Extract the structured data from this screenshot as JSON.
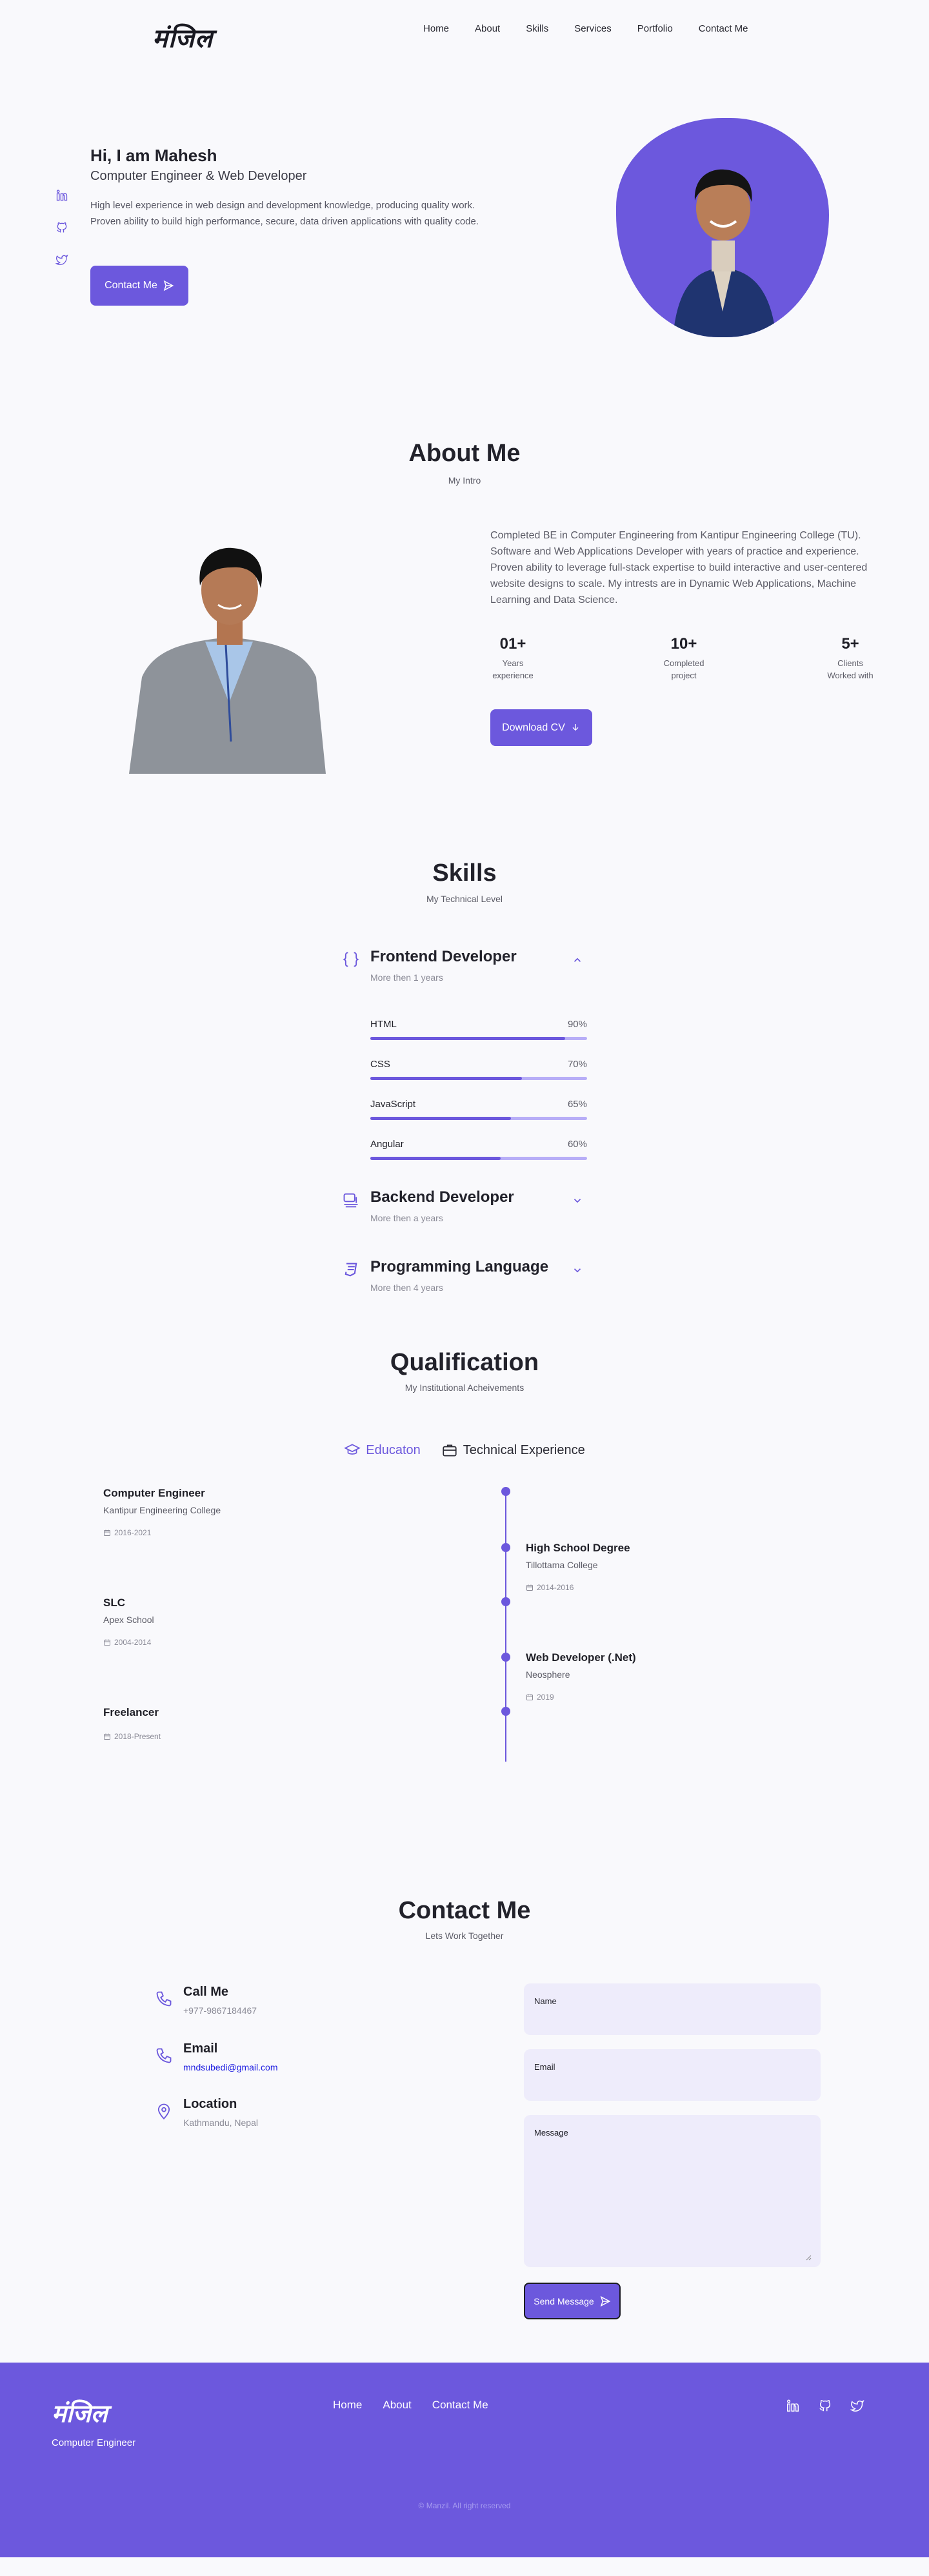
{
  "brand": {
    "logo": "मंजिल"
  },
  "nav": {
    "items": [
      "Home",
      "About",
      "Skills",
      "Services",
      "Portfolio",
      "Contact Me"
    ]
  },
  "hero": {
    "title": "Hi, I am Mahesh",
    "subtitle": "Computer Engineer & Web Developer",
    "description": "High level experience in web design and development knowledge, producing quality work. Proven ability to build high performance, secure, data driven applications with quality code.",
    "button": "Contact Me",
    "socials": [
      "linkedin-icon",
      "github-icon",
      "twitter-icon"
    ]
  },
  "about": {
    "title": "About Me",
    "subtitle": "My Intro",
    "text": "Completed BE in Computer Engineering from Kantipur Engineering College (TU). Software and Web Applications Developer with years of practice and experience. Proven ability to leverage full-stack expertise to build interactive and user-centered website designs to scale. My intrests are in Dynamic Web Applications, Machine Learning and Data Science.",
    "stats": [
      {
        "value": "01+",
        "label1": "Years",
        "label2": "experience"
      },
      {
        "value": "10+",
        "label1": "Completed",
        "label2": "project"
      },
      {
        "value": "5+",
        "label1": "Clients",
        "label2": "Worked with"
      }
    ],
    "cv_button": "Download CV"
  },
  "skills": {
    "title": "Skills",
    "subtitle": "My Technical Level",
    "groups": [
      {
        "title": "Frontend Developer",
        "sub": "More then 1 years"
      },
      {
        "title": "Backend Developer",
        "sub": "More then a years"
      },
      {
        "title": "Programming Language",
        "sub": "More then 4 years"
      }
    ],
    "frontend": [
      {
        "name": "HTML",
        "percent": "90%",
        "value": 90
      },
      {
        "name": "CSS",
        "percent": "70%",
        "value": 70
      },
      {
        "name": "JavaScript",
        "percent": "65%",
        "value": 65
      },
      {
        "name": "Angular",
        "percent": "60%",
        "value": 60
      }
    ]
  },
  "qualification": {
    "title": "Qualification",
    "subtitle": "My Institutional Acheivements",
    "tabs": [
      "Educaton",
      "Technical Experience"
    ],
    "items": [
      {
        "title": "Computer Engineer",
        "sub": "Kantipur Engineering College",
        "date": "2016-2021"
      },
      {
        "title": "High School Degree",
        "sub": "Tillottama College",
        "date": "2014-2016"
      },
      {
        "title": "SLC",
        "sub": "Apex School",
        "date": "2004-2014"
      },
      {
        "title": "Web Developer (.Net)",
        "sub": "Neosphere",
        "date": "2019"
      },
      {
        "title": "Freelancer",
        "sub": "",
        "date": "2018-Present"
      }
    ]
  },
  "contact": {
    "title": "Contact Me",
    "subtitle": "Lets Work Together",
    "items": [
      {
        "title": "Call Me",
        "value": "+977-9867184467"
      },
      {
        "title": "Email",
        "value": "mndsubedi@gmail.com"
      },
      {
        "title": "Location",
        "value": "Kathmandu, Nepal"
      }
    ],
    "fields": {
      "name": "Name",
      "email": "Email",
      "message": "Message"
    },
    "send": "Send Message"
  },
  "footer": {
    "logo": "मंजिल",
    "subtitle": "Computer Engineer",
    "links": [
      "Home",
      "About",
      "Contact Me"
    ],
    "copyright": "© Manzil. All right reserved"
  },
  "colors": {
    "accent": "#6c58dd",
    "accent_light": "#b8aef7",
    "background": "#f9f9fc"
  }
}
